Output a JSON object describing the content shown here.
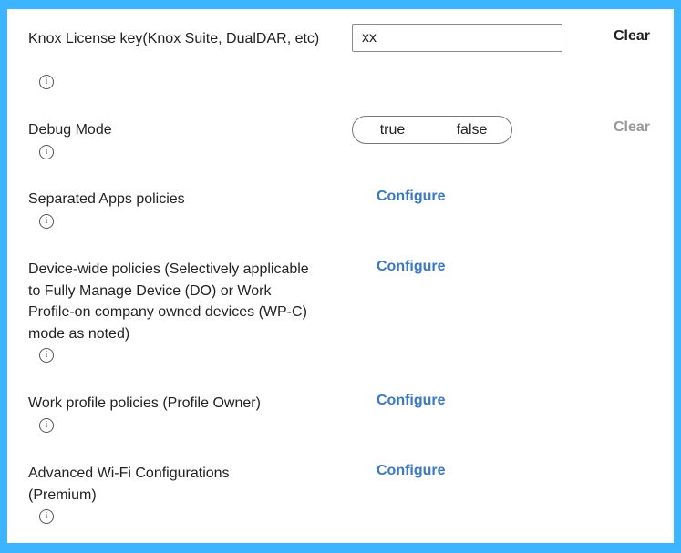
{
  "settings": [
    {
      "label": "Knox License key(Knox Suite, DualDAR, etc)",
      "value": "xx",
      "clear": "Clear"
    },
    {
      "label": "Debug Mode",
      "options": [
        "true",
        "false"
      ],
      "clear": "Clear"
    },
    {
      "label": "Separated Apps policies",
      "action": "Configure"
    },
    {
      "label": "Device-wide policies (Selectively applicable to Fully Manage Device (DO) or Work Profile-on company owned devices (WP-C) mode as noted)",
      "action": "Configure"
    },
    {
      "label": "Work profile policies (Profile Owner)",
      "action": "Configure"
    },
    {
      "label": "Advanced Wi-Fi Configurations (Premium)",
      "action": "Configure"
    }
  ],
  "info_glyph": "i",
  "colors": {
    "frame": "#3db4ff",
    "link": "#3a78c4",
    "clear_enabled": "#222222",
    "clear_disabled": "#999999"
  }
}
